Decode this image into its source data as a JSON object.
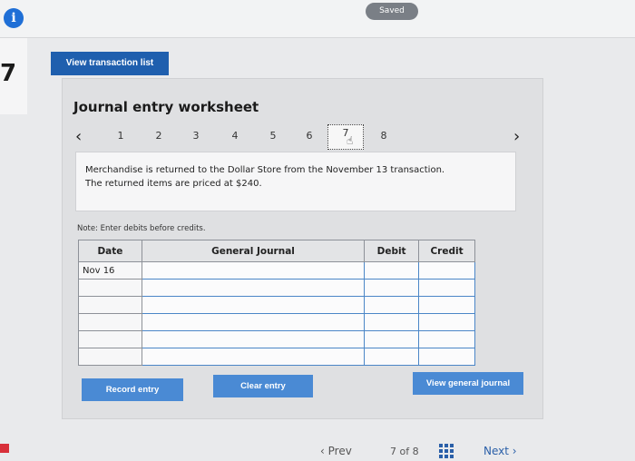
{
  "header": {
    "info_icon": "i",
    "saved_label": "Saved"
  },
  "question_number": "7",
  "toolbar": {
    "view_transaction_list": "View transaction list"
  },
  "worksheet": {
    "title": "Journal entry worksheet",
    "nav": {
      "prev_icon": "‹",
      "next_icon": "›",
      "steps": [
        "1",
        "2",
        "3",
        "4",
        "5",
        "6",
        "7",
        "8"
      ],
      "active_step": "7"
    },
    "prompt_line1": "Merchandise is returned to the Dollar Store from the November 13 transaction.",
    "prompt_line2": "The returned items are priced at $240.",
    "note": "Note: Enter debits before credits.",
    "table": {
      "headers": {
        "date": "Date",
        "general_journal": "General Journal",
        "debit": "Debit",
        "credit": "Credit"
      },
      "rows": [
        {
          "date": "Nov 16",
          "account": "",
          "debit": "",
          "credit": ""
        },
        {
          "date": "",
          "account": "",
          "debit": "",
          "credit": ""
        },
        {
          "date": "",
          "account": "",
          "debit": "",
          "credit": ""
        },
        {
          "date": "",
          "account": "",
          "debit": "",
          "credit": ""
        },
        {
          "date": "",
          "account": "",
          "debit": "",
          "credit": ""
        },
        {
          "date": "",
          "account": "",
          "debit": "",
          "credit": ""
        }
      ]
    },
    "buttons": {
      "record_entry": "Record entry",
      "clear_entry": "Clear entry",
      "view_general_journal": "View general journal"
    }
  },
  "footer": {
    "prev_label": "Prev",
    "page_indicator": "7 of 8",
    "next_label": "Next"
  },
  "colors": {
    "primary_button": "#1f5fae",
    "action_button": "#4a8ad4",
    "info_icon": "#1f6fd6"
  }
}
